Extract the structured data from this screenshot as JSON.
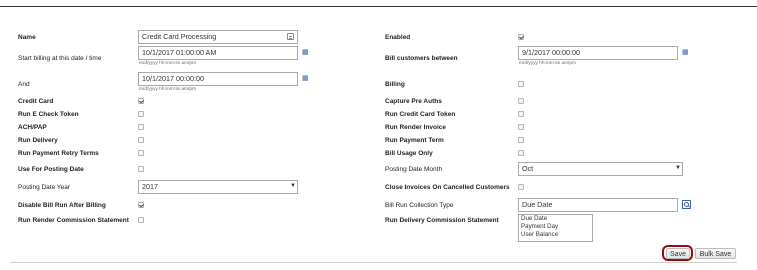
{
  "left": {
    "name": {
      "label": "Name",
      "value": "Credit Card Processing"
    },
    "start_billing": {
      "label": "Start billing at this date / time",
      "value": "10/1/2017 01:00:00 AM",
      "hint": "m/d/yyyy hh:mm:ss am/pm"
    },
    "and": {
      "label": "And",
      "value": "10/1/2017 00:00:00",
      "hint": "m/d/yyyy hh:mm:ss am/pm"
    },
    "credit_card": {
      "label": "Credit Card",
      "checked": true
    },
    "run_echeck_token": {
      "label": "Run E Check Token",
      "checked": false
    },
    "ach_pap": {
      "label": "ACH/PAP",
      "checked": false
    },
    "run_delivery": {
      "label": "Run Delivery",
      "checked": false
    },
    "run_payment_retry": {
      "label": "Run Payment Retry Terms",
      "checked": false
    },
    "use_for_posting_date": {
      "label": "Use For Posting Date",
      "checked": false
    },
    "posting_date_year": {
      "label": "Posting Date Year",
      "value": "2017"
    },
    "disable_bill_run": {
      "label": "Disable Bill Run After Billing",
      "checked": true
    },
    "run_render_commission": {
      "label": "Run Render Commission Statement",
      "checked": false
    }
  },
  "right": {
    "enabled": {
      "label": "Enabled",
      "checked": true
    },
    "bill_customers_between": {
      "label": "Bill customers between",
      "value": "9/1/2017 00:00:00",
      "hint": "m/d/yyyy hh:mm:ss am/pm"
    },
    "billing": {
      "label": "Billing",
      "checked": false
    },
    "capture_pre_auths": {
      "label": "Capture Pre Auths",
      "checked": false
    },
    "run_credit_card_token": {
      "label": "Run Credit Card Token",
      "checked": false
    },
    "run_render_invoice": {
      "label": "Run Render Invoice",
      "checked": false
    },
    "run_payment_term": {
      "label": "Run Payment Term",
      "checked": false
    },
    "bill_usage_only": {
      "label": "Bill Usage Only",
      "checked": false
    },
    "posting_date_month": {
      "label": "Posting Date Month",
      "value": "Oct"
    },
    "close_invoices": {
      "label": "Close Invoices On Cancelled Customers",
      "checked": false
    },
    "bill_run_collection_type": {
      "label": "Bill Run Collection Type",
      "value": "Due Date",
      "options": [
        "Due Date",
        "Payment Day",
        "User Balance"
      ]
    },
    "run_delivery_commission": {
      "label": "Run Delivery Commission Statement"
    }
  },
  "buttons": {
    "save": "Save",
    "bulk_save": "Bulk Save"
  },
  "colors": {
    "accent": "#3a5ea8",
    "highlight_ring": "#8b1010"
  },
  "icons": {
    "calendar": "calendar-icon",
    "edit": "edit-icon",
    "search": "search-icon",
    "dropdown": "chevron-down-icon"
  }
}
